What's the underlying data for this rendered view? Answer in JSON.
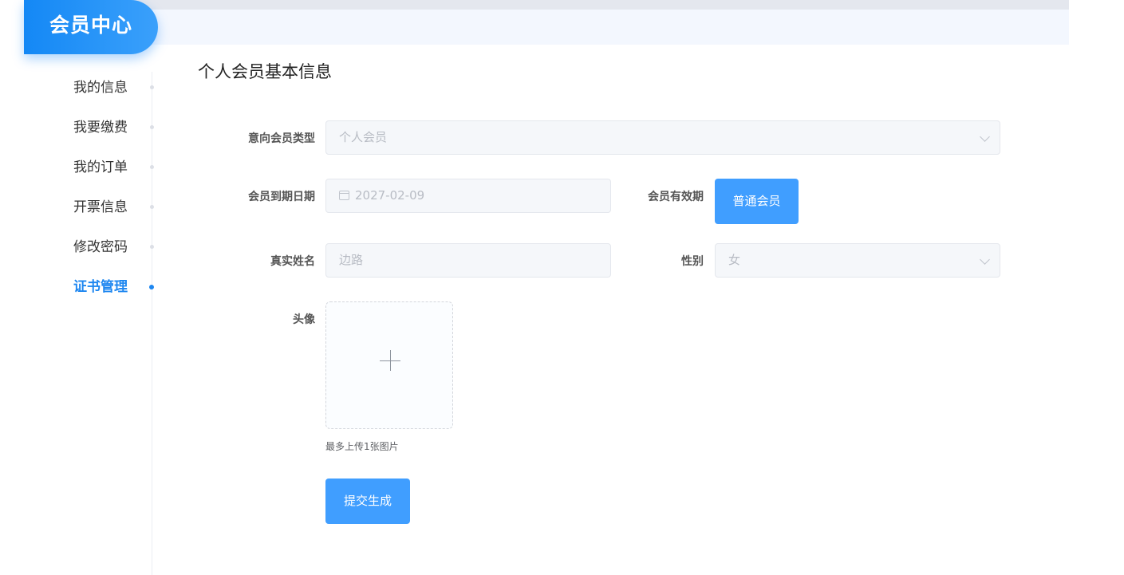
{
  "brand": {
    "title": "会员中心"
  },
  "sidebar": {
    "items": [
      {
        "label": "我的信息",
        "active": false
      },
      {
        "label": "我要缴费",
        "active": false
      },
      {
        "label": "我的订单",
        "active": false
      },
      {
        "label": "开票信息",
        "active": false
      },
      {
        "label": "修改密码",
        "active": false
      },
      {
        "label": "证书管理",
        "active": true
      }
    ]
  },
  "form": {
    "title": "个人会员基本信息",
    "member_type": {
      "label": "意向会员类型",
      "value": "个人会员"
    },
    "expiry_date": {
      "label": "会员到期日期",
      "value": "2027-02-09"
    },
    "validity": {
      "label": "会员有效期",
      "button_label": "普通会员"
    },
    "real_name": {
      "label": "真实姓名",
      "value": "边路"
    },
    "gender": {
      "label": "性别",
      "value": "女"
    },
    "avatar": {
      "label": "头像",
      "hint": "最多上传1张图片"
    },
    "submit_label": "提交生成"
  },
  "colors": {
    "accent": "#409eff",
    "brand": "#1488f5",
    "active_menu": "#1e87f0"
  }
}
